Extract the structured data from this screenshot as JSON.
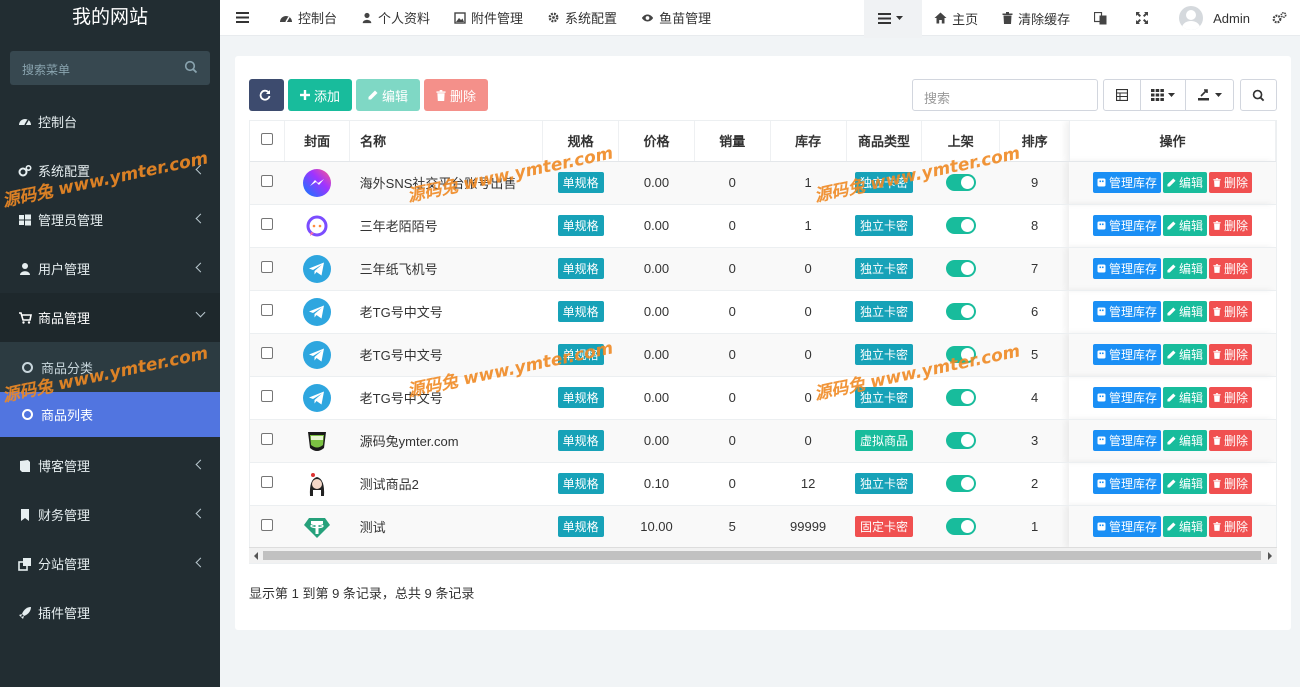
{
  "sidebar": {
    "brand": "我的网站",
    "search_placeholder": "搜索菜单",
    "items": [
      {
        "label": "控制台"
      },
      {
        "label": "系统配置"
      },
      {
        "label": "管理员管理"
      },
      {
        "label": "用户管理"
      },
      {
        "label": "商品管理"
      },
      {
        "label": "博客管理"
      },
      {
        "label": "财务管理"
      },
      {
        "label": "分站管理"
      },
      {
        "label": "插件管理"
      }
    ],
    "sub_items": [
      {
        "label": "商品分类"
      },
      {
        "label": "商品列表"
      }
    ]
  },
  "topnav": {
    "links": [
      "控制台",
      "个人资料",
      "附件管理",
      "系统配置",
      "鱼苗管理"
    ],
    "home": "主页",
    "clear_cache": "清除缓存",
    "user": "Admin"
  },
  "toolbar": {
    "add": "添加",
    "edit": "编辑",
    "delete": "删除",
    "search_placeholder": "搜索"
  },
  "table": {
    "headers": [
      "封面",
      "名称",
      "规格",
      "价格",
      "销量",
      "库存",
      "商品类型",
      "上架",
      "排序",
      "操作"
    ],
    "rows": [
      {
        "name": "海外SNS社交平台账号出售",
        "spec": "单规格",
        "price": "0.00",
        "sales": "0",
        "stock": "1",
        "type": "独立卡密",
        "sort": "9",
        "icon": "messenger-icon"
      },
      {
        "name": "三年老陌陌号",
        "spec": "单规格",
        "price": "0.00",
        "sales": "0",
        "stock": "1",
        "type": "独立卡密",
        "sort": "8",
        "icon": "momo-icon"
      },
      {
        "name": "三年纸飞机号",
        "spec": "单规格",
        "price": "0.00",
        "sales": "0",
        "stock": "0",
        "type": "独立卡密",
        "sort": "7",
        "icon": "telegram-icon"
      },
      {
        "name": "老TG号中文号",
        "spec": "单规格",
        "price": "0.00",
        "sales": "0",
        "stock": "0",
        "type": "独立卡密",
        "sort": "6",
        "icon": "telegram-icon"
      },
      {
        "name": "老TG号中文号",
        "spec": "单规格",
        "price": "0.00",
        "sales": "0",
        "stock": "0",
        "type": "独立卡密",
        "sort": "5",
        "icon": "telegram-icon"
      },
      {
        "name": "老TG号中文号",
        "spec": "单规格",
        "price": "0.00",
        "sales": "0",
        "stock": "0",
        "type": "独立卡密",
        "sort": "4",
        "icon": "telegram-icon"
      },
      {
        "name": "源码兔ymter.com",
        "spec": "单规格",
        "price": "0.00",
        "sales": "0",
        "stock": "0",
        "type": "虚拟商品",
        "sort": "3",
        "icon": "wechat-pay-icon"
      },
      {
        "name": "测试商品2",
        "spec": "单规格",
        "price": "0.10",
        "sales": "0",
        "stock": "12",
        "type": "独立卡密",
        "sort": "2",
        "icon": "avatar-girl-icon"
      },
      {
        "name": "测试",
        "spec": "单规格",
        "price": "10.00",
        "sales": "5",
        "stock": "99999",
        "type": "固定卡密",
        "sort": "1",
        "icon": "tether-icon"
      }
    ],
    "ops": {
      "stock": "管理库存",
      "edit": "编辑",
      "delete": "删除"
    }
  },
  "colors": {
    "type_independent": "#17a2b8",
    "type_virtual": "#18bc9c",
    "type_fixed": "#f05050"
  },
  "pagination": "显示第 1 到第 9 条记录，总共 9 条记录",
  "watermark": "源码兔 www.ymter.com"
}
